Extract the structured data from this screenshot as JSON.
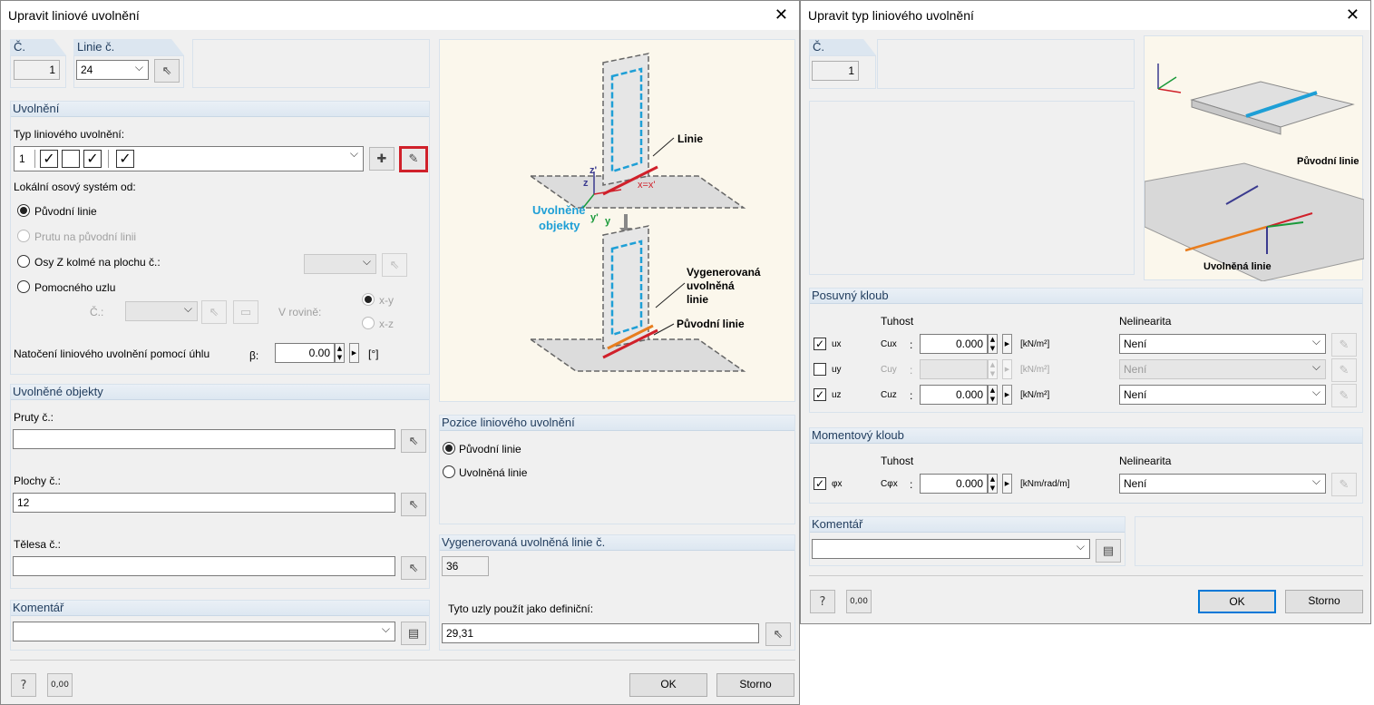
{
  "left": {
    "title": "Upravit liniové uvolnění",
    "no": {
      "label": "Č.",
      "value": "1"
    },
    "line": {
      "label": "Linie č.",
      "value": "24"
    },
    "release": {
      "section": "Uvolnění",
      "type_label": "Typ liniového uvolnění:",
      "type_value": "1",
      "type_checks": [
        "✓",
        "",
        "✓",
        "✓"
      ],
      "axis_label": "Lokální osový systém od:",
      "opt_original": "Původní linie",
      "opt_member": "Prutu na původní linii",
      "opt_zaxes": "Osy Z kolmé na plochu č.:",
      "opt_helper": "Pomocného uzlu",
      "helper_no": "Č.:",
      "in_plane": "V rovině:",
      "plane_xy": "x-y",
      "plane_xz": "x-z",
      "rotation_label": "Natočení liniového uvolnění pomocí úhlu",
      "beta": "β:",
      "rotation_value": "0.00",
      "unit": "[°]"
    },
    "released": {
      "section": "Uvolněné objekty",
      "members_label": "Pruty č.:",
      "members_value": "",
      "surfaces_label": "Plochy č.:",
      "surfaces_value": "12",
      "solids_label": "Tělesa č.:",
      "solids_value": ""
    },
    "comment": {
      "section": "Komentář",
      "value": ""
    },
    "picture": {
      "linie": "Linie",
      "uvolnene": "Uvolněné",
      "objekty": "objekty",
      "vyg1": "Vygenerovaná",
      "vyg2": "uvolněná",
      "vyg3": "linie",
      "puvodni": "Původní linie",
      "xx": "x=x'",
      "z1": "z'",
      "z2": "z",
      "y1": "y'",
      "y2": "y"
    },
    "position": {
      "section": "Pozice liniového uvolnění",
      "opt1": "Původní linie",
      "opt2": "Uvolněná linie"
    },
    "generated": {
      "section": "Vygenerovaná uvolněná linie č.",
      "value": "36",
      "nodes_label": "Tyto uzly použít jako definiční:",
      "nodes_value": "29,31"
    },
    "ok": "OK",
    "cancel": "Storno",
    "units_icon": "0,00"
  },
  "right": {
    "title": "Upravit typ liniového uvolnění",
    "no": {
      "label": "Č.",
      "value": "1"
    },
    "picture": {
      "puvodni": "Původní linie",
      "uvolnena": "Uvolněná linie"
    },
    "translational": {
      "section": "Posuvný kloub",
      "stiffness": "Tuhost",
      "nonlinearity": "Nelinearita",
      "rows": [
        {
          "check": "✓",
          "dof": "ux",
          "sym": "Cux",
          "value": "0.000",
          "unit": "[kN/m²]",
          "nl": "Není",
          "enabled": true
        },
        {
          "check": "",
          "dof": "uy",
          "sym": "Cuy",
          "value": "",
          "unit": "[kN/m²]",
          "nl": "Není",
          "enabled": false
        },
        {
          "check": "✓",
          "dof": "uz",
          "sym": "Cuz",
          "value": "0.000",
          "unit": "[kN/m²]",
          "nl": "Není",
          "enabled": true
        }
      ]
    },
    "rotational": {
      "section": "Momentový kloub",
      "stiffness": "Tuhost",
      "nonlinearity": "Nelinearita",
      "row": {
        "check": "✓",
        "dof": "φx",
        "sym": "Cφx",
        "value": "0.000",
        "unit": "[kNm/rad/m]",
        "nl": "Není"
      }
    },
    "comment": {
      "section": "Komentář",
      "value": ""
    },
    "ok": "OK",
    "cancel": "Storno",
    "units_icon": "0,00"
  },
  "colors": {
    "accent_red": "#d0202a",
    "blue_label": "#1e9fd6",
    "panel_head": "#dce6f0"
  }
}
